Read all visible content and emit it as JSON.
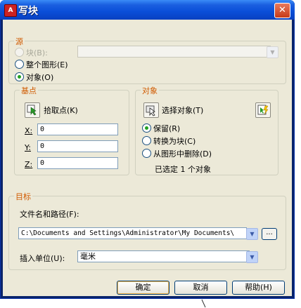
{
  "title": "写块",
  "source": {
    "label": "源",
    "block_option": "块(B):",
    "entire_drawing_option": "整个图形(E)",
    "objects_option": "对象(O)"
  },
  "base_point": {
    "label": "基点",
    "pick_point_label": "拾取点(K)",
    "x_label": "X:",
    "x_value": "0",
    "y_label": "Y:",
    "y_value": "0",
    "z_label": "Z:",
    "z_value": "0"
  },
  "objects": {
    "label": "对象",
    "select_objects_label": "选择对象(T)",
    "retain_option": "保留(R)",
    "convert_option": "转换为块(C)",
    "delete_option": "从图形中删除(D)",
    "status": "已选定 1 个对象"
  },
  "destination": {
    "label": "目标",
    "path_label": "文件名和路径(F):",
    "path_value": "C:\\Documents and Settings\\Administrator\\My Documents\\",
    "browse_label": "...",
    "units_label": "插入单位(U):",
    "units_value": "毫米"
  },
  "buttons": {
    "ok": "确定",
    "cancel": "取消",
    "help": "帮助(H)"
  },
  "colors": {
    "titlebar": "#0a4ed8",
    "group_title": "#d05a00",
    "client_bg": "#ece9d8",
    "radio_selected": "#21a121"
  }
}
